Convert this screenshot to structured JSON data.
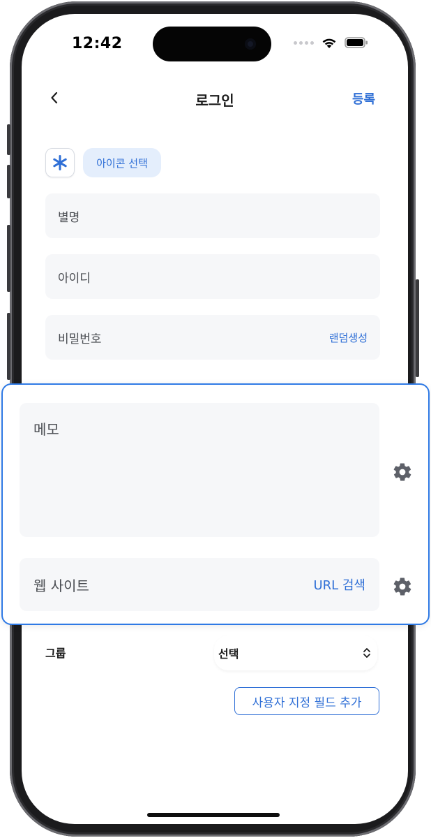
{
  "status_bar": {
    "time": "12:42"
  },
  "nav": {
    "title": "로그인",
    "action_label": "등록"
  },
  "icon_picker": {
    "chip_label": "아이콘 선택"
  },
  "fields": {
    "alias": {
      "label": "별명"
    },
    "user_id": {
      "label": "아이디"
    },
    "password": {
      "label": "비밀번호",
      "action_label": "랜덤생성"
    },
    "memo": {
      "label": "메모"
    },
    "website": {
      "label": "웹 사이트",
      "action_label": "URL 검색"
    }
  },
  "group": {
    "label": "그룹",
    "selected": "선택"
  },
  "add_custom_field_label": "사용자 지정 필드 추가",
  "colors": {
    "accent": "#2f6fd6",
    "highlight_border": "#2f7ae5",
    "field_bg": "#f6f7f9"
  }
}
